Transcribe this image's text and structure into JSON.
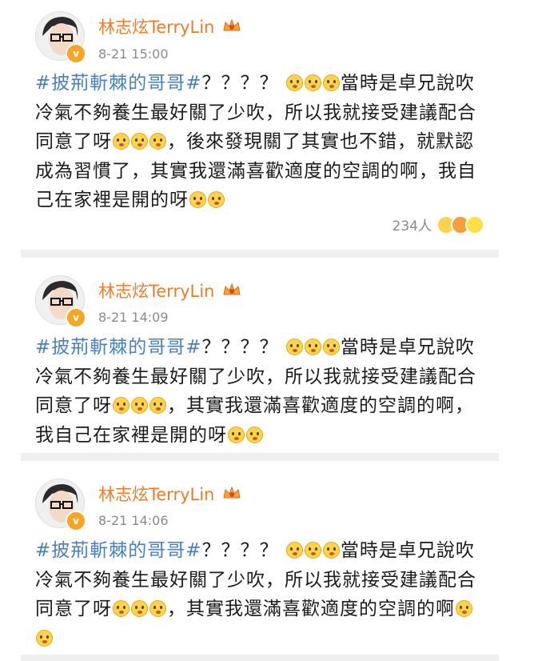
{
  "posts": [
    {
      "author": "林志炫TerryLin",
      "time": "8-21 15:00",
      "lines": [
        {
          "hashtag": "#披荊斬棘的哥哥#",
          "text": "？？？？",
          "emoji_count": 3,
          "tail": "當時是卓兄說吹"
        },
        {
          "text": "冷氣不夠養生最好關了少吹，所以我就接受建議配合"
        },
        {
          "text": "同意了呀",
          "emoji_count": 3,
          "tail": "，後來發現關了其實也不錯，就默認"
        },
        {
          "text": "成為習慣了，其實我還滿喜歡適度的空調的啊，我自"
        },
        {
          "text": "己在家裡是開的呀",
          "emoji_count": 2,
          "tail": ""
        }
      ],
      "likes": "234人",
      "reactions": [
        "surprised",
        "kiss",
        "laugh"
      ]
    },
    {
      "author": "林志炫TerryLin",
      "time": "8-21 14:09",
      "lines": [
        {
          "hashtag": "#披荊斬棘的哥哥#",
          "text": "？？？？",
          "emoji_count": 3,
          "tail": "當時是卓兄說吹"
        },
        {
          "text": "冷氣不夠養生最好關了少吹，所以我就接受建議配合"
        },
        {
          "text": "同意了呀",
          "emoji_count": 3,
          "tail": "，其實我還滿喜歡適度的空調的啊，"
        },
        {
          "text": "我自己在家裡是開的呀",
          "emoji_count": 2,
          "tail": ""
        }
      ]
    },
    {
      "author": "林志炫TerryLin",
      "time": "8-21 14:06",
      "lines": [
        {
          "hashtag": "#披荊斬棘的哥哥#",
          "text": "？？？？",
          "emoji_count": 3,
          "tail": "當時是卓兄說吹"
        },
        {
          "text": "冷氣不夠養生最好關了少吹，所以我就接受建議配合"
        },
        {
          "text": "同意了呀",
          "emoji_count": 3,
          "tail": "，其實我還滿喜歡適度的空調的啊",
          "end_emoji": 1
        },
        {
          "text": "",
          "emoji_count": 1,
          "tail": ""
        }
      ]
    }
  ],
  "colors": {
    "name": "#f07b2a",
    "hashtag": "#4a7fc1",
    "time": "#8a8a8a",
    "divider": "#efefef",
    "emoji": "#fcd34d"
  },
  "icons": {
    "verified": "verified-v-badge",
    "crown": "vip-crown-icon",
    "emoji": "surprised-face-emoji"
  }
}
